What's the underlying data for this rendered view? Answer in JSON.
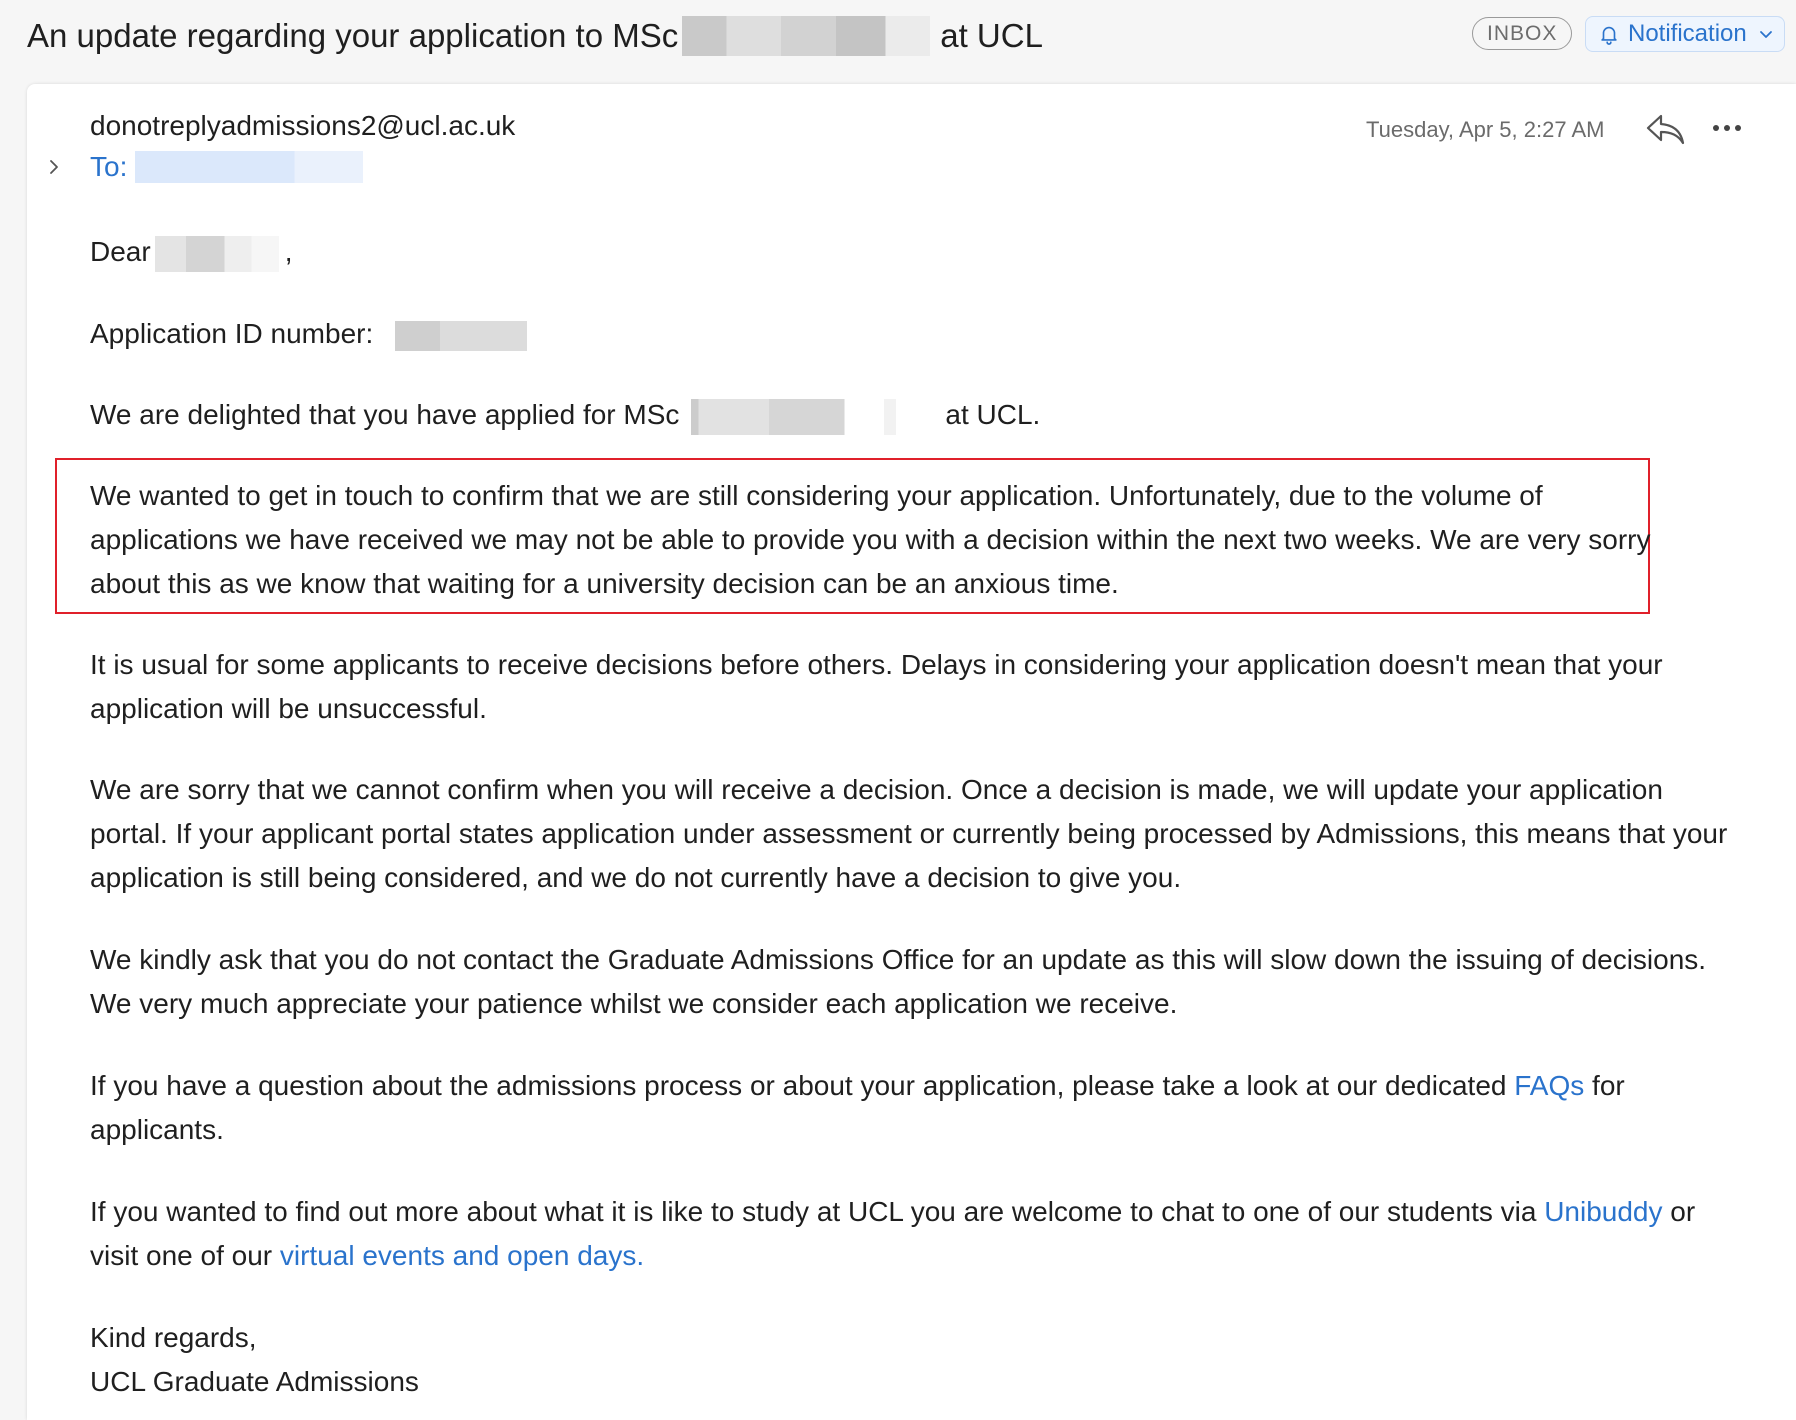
{
  "header": {
    "subject_prefix": "An update regarding your application to MSc",
    "subject_suffix": "at UCL",
    "inbox_badge": "INBOX",
    "notification_label": "Notification"
  },
  "email": {
    "sender": "donotreplyadmissions2@ucl.ac.uk",
    "to_label": "To:",
    "timestamp": "Tuesday, Apr 5, 2:27 AM"
  },
  "body": {
    "greeting": "Dear",
    "greeting_end": ",",
    "app_id_label": "Application ID number:",
    "p1_prefix": "We are delighted that you have applied for MSc",
    "p1_suffix": "at UCL.",
    "p2": "We wanted to get in touch to confirm that we are still considering your application. Unfortunately, due to the volume of applications we have received we may not be able to provide you with a decision within the next two weeks. We are very sorry about this as we know that waiting for a university decision can be an anxious time.",
    "p3": "It is usual for some applicants to receive decisions before others. Delays in considering your application doesn't mean that your application will be unsuccessful.",
    "p4": "We are sorry that we cannot confirm when you will receive a decision. Once a decision is made, we will update your application portal. If your applicant portal states application under assessment or currently being processed by Admissions, this means that your application is still being considered, and we do not currently have a decision to give you.",
    "p5": "We kindly ask that you do not contact the Graduate Admissions Office for an update as this will slow down the issuing of decisions. We very much appreciate your patience whilst we consider each application we receive.",
    "p6_prefix": "If you have a question about the admissions process or about your application, please take a look at our dedicated",
    "p6_link": "FAQs",
    "p6_suffix": "for applicants.",
    "p7_prefix": "If you wanted to find out more about what it is like to study at UCL you are welcome to chat to one of our students via",
    "p7_link1": "Unibuddy",
    "p7_middle": "or visit one of our",
    "p7_link2": "virtual events and open days.",
    "signoff": "Kind regards,",
    "signature": "UCL Graduate Admissions"
  },
  "colors": {
    "link": "#2a73cc",
    "highlight_border": "#e0202a"
  },
  "icons": {
    "notification": "bell-icon",
    "notification_dropdown": "chevron-down-icon",
    "expand": "chevron-right-icon",
    "reply": "reply-icon",
    "more": "more-icon"
  }
}
